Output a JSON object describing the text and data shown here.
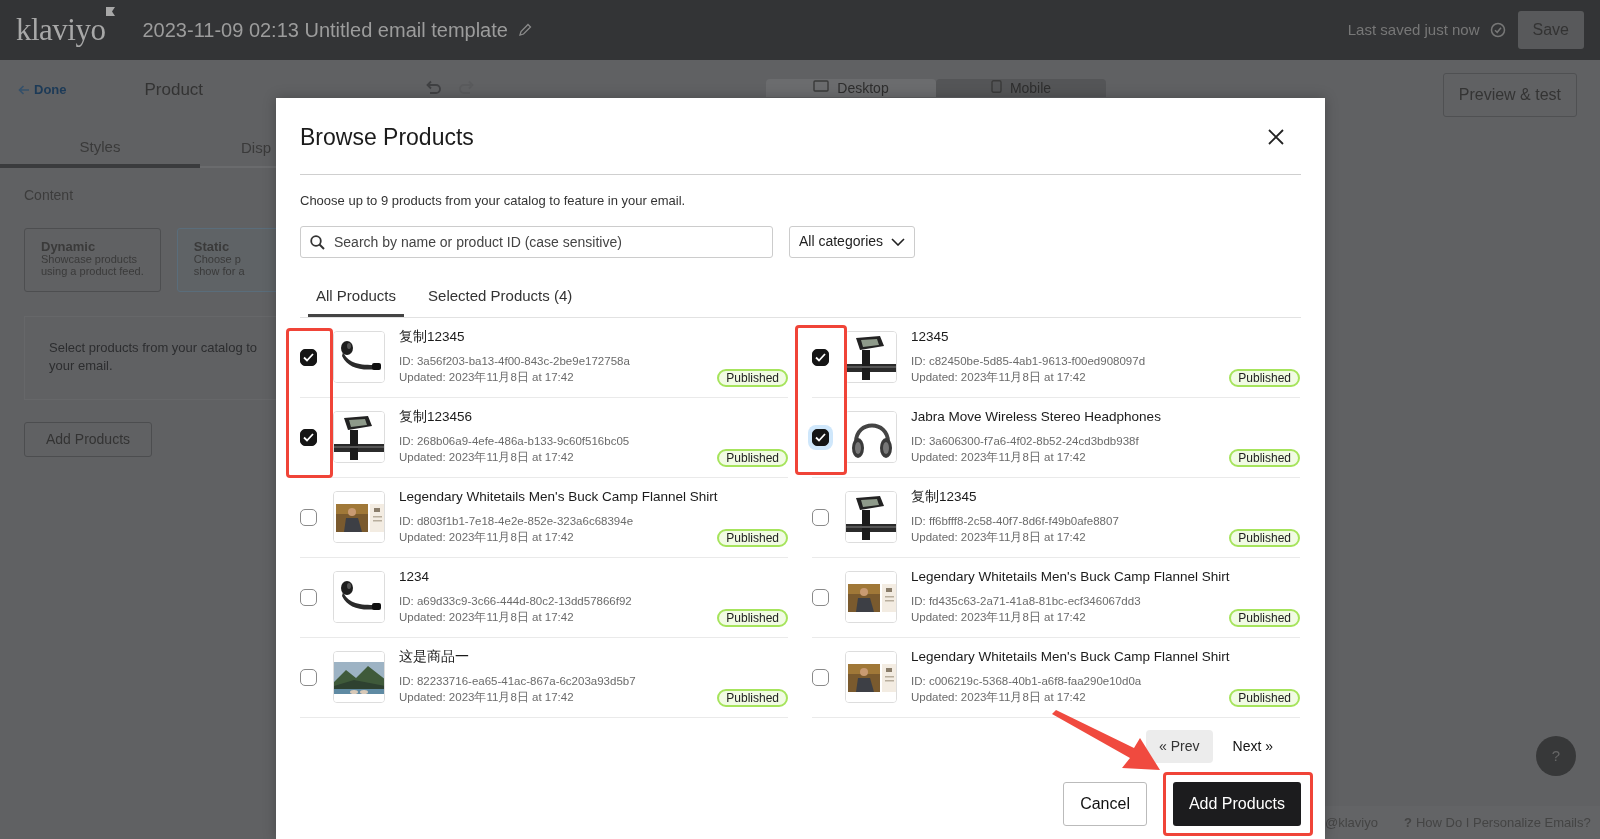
{
  "app_header": {
    "logo": "klaviyo",
    "title": "2023-11-09 02:13 Untitled email template",
    "save_status": "Last saved just now",
    "save_button": "Save"
  },
  "editor_toolbar": {
    "back_link": "Done",
    "panel_title": "Product",
    "view_tabs": [
      {
        "label": "Desktop",
        "selected": true
      },
      {
        "label": "Mobile",
        "selected": false
      }
    ],
    "preview_button": "Preview & test"
  },
  "side_panel": {
    "tabs": [
      {
        "label": "Styles",
        "selected": true
      },
      {
        "label": "Disp",
        "selected": false
      }
    ],
    "section_label": "Content",
    "source_options": [
      {
        "title": "Dynamic",
        "description_lines": [
          "Showcase products",
          "using a product feed."
        ],
        "selected": false
      },
      {
        "title": "Static",
        "description_lines": [
          "Choose p",
          "show for a"
        ],
        "selected": true
      }
    ],
    "empty_message_lines": [
      "Select products from your catalog to",
      "your email."
    ],
    "add_button": "Add Products"
  },
  "modal": {
    "title": "Browse Products",
    "description": "Choose up to 9 products from your catalog to feature in your email.",
    "search": {
      "placeholder": "Search by name or product ID (case sensitive)"
    },
    "category_select": "All categories",
    "tabs": [
      {
        "label": "All Products",
        "selected": true
      },
      {
        "label": "Selected Products (4)",
        "selected": false
      }
    ],
    "columns": [
      {
        "products": [
          {
            "name": "复制12345",
            "id_text": "ID: 3a56f203-ba13-4f00-843c-2be9e172758a",
            "updated": "Updated: 2023年11月8日 at 17:42",
            "status": "Published",
            "checked": true,
            "focused": false
          },
          {
            "name": "复制123456",
            "id_text": "ID: 268b06a9-4efe-486a-b133-9c60f516bc05",
            "updated": "Updated: 2023年11月8日 at 17:42",
            "status": "Published",
            "checked": true,
            "focused": false
          },
          {
            "name": "Legendary Whitetails Men's Buck Camp Flannel Shirt",
            "id_text": "ID: d803f1b1-7e18-4e2e-852e-323a6c68394e",
            "updated": "Updated: 2023年11月8日 at 17:42",
            "status": "Published",
            "checked": false,
            "focused": false
          },
          {
            "name": "1234",
            "id_text": "ID: a69d33c9-3c66-444d-80c2-13dd57866f92",
            "updated": "Updated: 2023年11月8日 at 17:42",
            "status": "Published",
            "checked": false,
            "focused": false
          },
          {
            "name": "这是商品一",
            "id_text": "ID: 82233716-ea65-41ac-867a-6c203a93d5b7",
            "updated": "Updated: 2023年11月8日 at 17:42",
            "status": "Published",
            "checked": false,
            "focused": false
          }
        ]
      },
      {
        "products": [
          {
            "name": "12345",
            "id_text": "ID: c82450be-5d85-4ab1-9613-f00ed908097d",
            "updated": "Updated: 2023年11月8日 at 17:42",
            "status": "Published",
            "checked": true,
            "focused": false
          },
          {
            "name": "Jabra Move Wireless Stereo Headphones",
            "id_text": "ID: 3a606300-f7a6-4f02-8b52-24cd3bdb938f",
            "updated": "Updated: 2023年11月8日 at 17:42",
            "status": "Published",
            "checked": true,
            "focused": true
          },
          {
            "name": "复制12345",
            "id_text": "ID: ff6bfff8-2c58-40f7-8d6f-f49b0afe8807",
            "updated": "Updated: 2023年11月8日 at 17:42",
            "status": "Published",
            "checked": false,
            "focused": false
          },
          {
            "name": "Legendary Whitetails Men's Buck Camp Flannel Shirt",
            "id_text": "ID: fd435c63-2a71-41a8-81bc-ecf346067dd3",
            "updated": "Updated: 2023年11月8日 at 17:42",
            "status": "Published",
            "checked": false,
            "focused": false
          },
          {
            "name": "Legendary Whitetails Men's Buck Camp Flannel Shirt",
            "id_text": "ID: c006219c-5368-40b1-a6f8-faa290e10d0a",
            "updated": "Updated: 2023年11月8日 at 17:42",
            "status": "Published",
            "checked": false,
            "focused": false
          }
        ]
      }
    ],
    "pagination": {
      "prev": "« Prev",
      "next": "Next »"
    },
    "cancel_button": "Cancel",
    "confirm_button": "Add Products"
  },
  "help_button": "?",
  "footer_links": [
    {
      "label": "@klaviyo"
    },
    {
      "icon": "?",
      "label": "How Do I Personalize Emails?"
    }
  ]
}
